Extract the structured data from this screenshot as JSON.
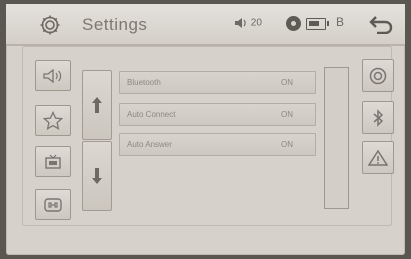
{
  "header": {
    "title": "Settings",
    "volume_level": "20",
    "bluetooth_symbol": "B"
  },
  "settings_rows": [
    {
      "label": "Bluetooth",
      "value": "ON"
    },
    {
      "label": "Auto Connect",
      "value": "ON"
    },
    {
      "label": "Auto Answer",
      "value": "ON"
    }
  ],
  "icons": {
    "left": [
      "speaker-icon",
      "star-icon",
      "media-icon",
      "phone-icon"
    ],
    "right": [
      "disc-icon",
      "bluetooth-icon",
      "warning-icon"
    ]
  },
  "colors": {
    "screen_bg": "#d6d2cb",
    "icon": "#7a7570"
  }
}
